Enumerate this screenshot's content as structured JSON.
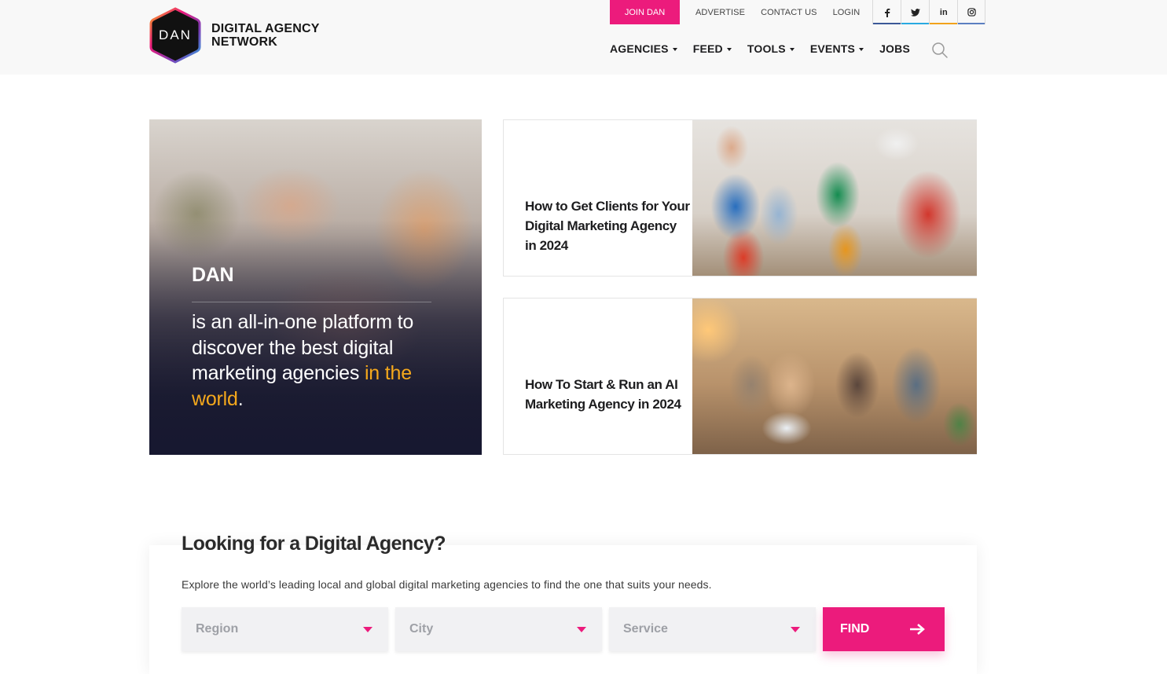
{
  "header": {
    "logo": {
      "monogram": "DAN",
      "line1": "DIGITAL AGENCY",
      "line2": "NETWORK"
    },
    "join_label": "JOIN DAN",
    "top_links": [
      {
        "label": "ADVERTISE"
      },
      {
        "label": "CONTACT US"
      },
      {
        "label": "LOGIN"
      }
    ],
    "socials": [
      {
        "icon": "facebook-icon",
        "glyph": "f"
      },
      {
        "icon": "twitter-icon",
        "glyph": "t"
      },
      {
        "icon": "linkedin-icon",
        "glyph": "in"
      },
      {
        "icon": "instagram-icon",
        "glyph": "◎"
      }
    ],
    "nav": [
      {
        "label": "AGENCIES",
        "dropdown": true
      },
      {
        "label": "FEED",
        "dropdown": true
      },
      {
        "label": "TOOLS",
        "dropdown": true
      },
      {
        "label": "EVENTS",
        "dropdown": true
      },
      {
        "label": "JOBS",
        "dropdown": false
      }
    ],
    "search_icon": "search-icon"
  },
  "hero": {
    "brand": "DAN",
    "tagline_main": "is an all-in-one platform to discover the best digital marketing agencies",
    "tagline_highlight": "in the world",
    "tagline_end": "."
  },
  "articles": [
    {
      "title": "How to Get Clients for Your Digital Marketing Agency in 2024"
    },
    {
      "title": "How To Start & Run an AI Marketing Agency in 2024"
    }
  ],
  "search": {
    "heading": "Looking for a Digital Agency?",
    "subtitle": "Explore the world’s leading local and global digital marketing agencies to find the one that suits your needs.",
    "region_placeholder": "Region",
    "city_placeholder": "City",
    "service_placeholder": "Service",
    "find_label": "FIND"
  },
  "colors": {
    "accent": "#ec1b7c",
    "highlight": "#f5a81c",
    "text": "#1d1d1f"
  }
}
